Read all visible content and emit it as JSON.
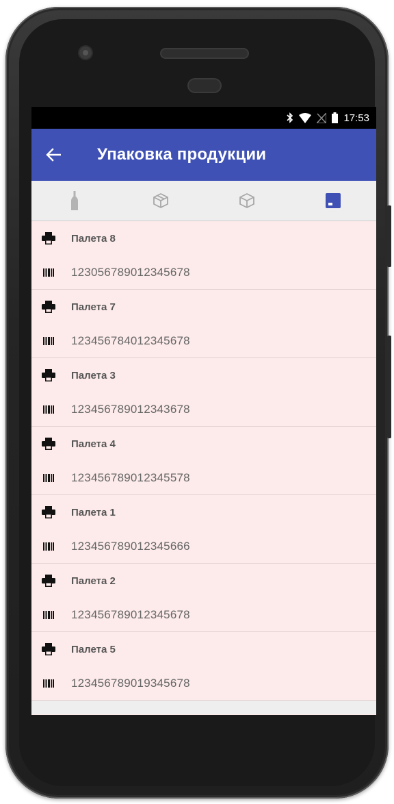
{
  "status_bar": {
    "time": "17:53",
    "icons": [
      "bluetooth-icon",
      "wifi-icon",
      "no-sim-icon",
      "battery-icon"
    ]
  },
  "app_bar": {
    "back_icon": "arrow-left-icon",
    "title": "Упаковка продукции"
  },
  "tabs": [
    {
      "icon": "bottle-icon",
      "selected": false
    },
    {
      "icon": "box-open-icon",
      "selected": false
    },
    {
      "icon": "box-icon",
      "selected": false
    },
    {
      "icon": "pallet-icon",
      "selected": true
    }
  ],
  "accent_color": "#3f51b5",
  "list_background": "#fdeaea",
  "items": [
    {
      "name": "Палета 8",
      "code": "123056789012345678"
    },
    {
      "name": "Палета 7",
      "code": "123456784012345678"
    },
    {
      "name": "Палета 3",
      "code": "123456789012343678"
    },
    {
      "name": "Палета 4",
      "code": "123456789012345578"
    },
    {
      "name": "Палета 1",
      "code": "123456789012345666"
    },
    {
      "name": "Палета 2",
      "code": "123456789012345678"
    },
    {
      "name": "Палета 5",
      "code": "123456789019345678"
    }
  ]
}
